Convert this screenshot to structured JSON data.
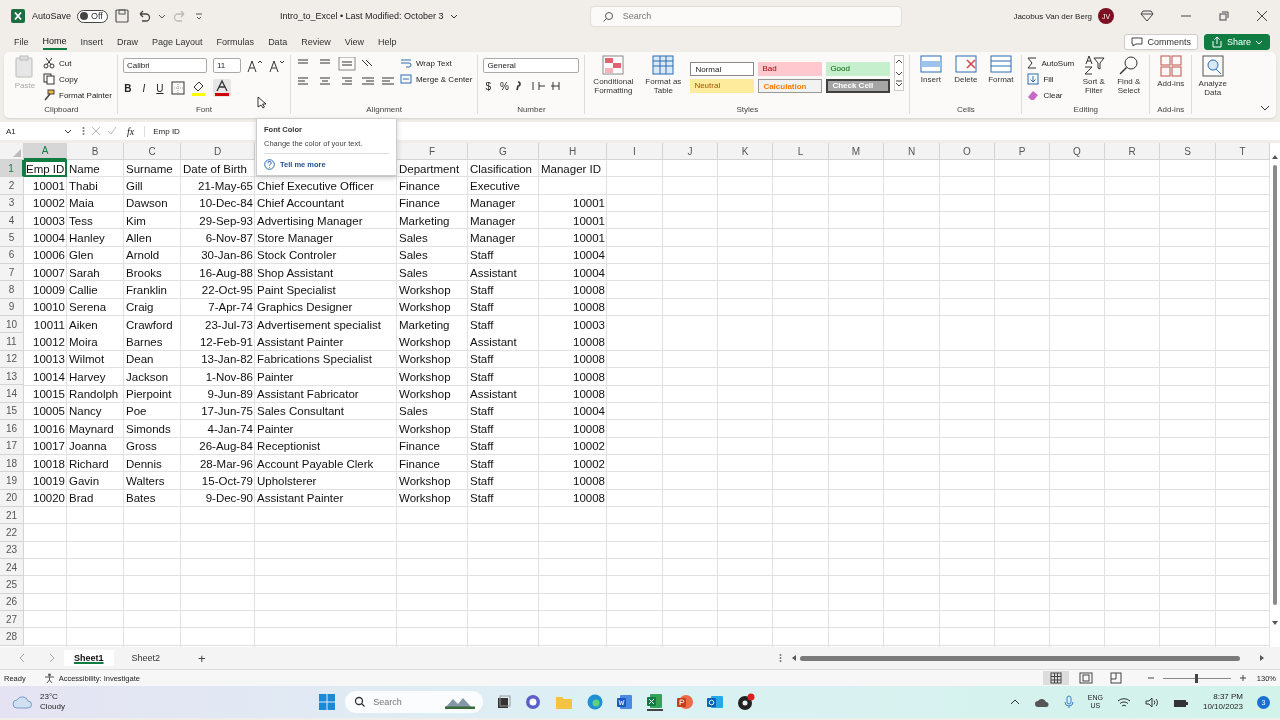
{
  "title_bar": {
    "autosave_label": "AutoSave",
    "autosave": {
      "label": "Off",
      "on": false
    },
    "document_title": "Intro_to_Excel • Last Modified: October 3",
    "search_placeholder": "Search",
    "user_name": "Jacobus Van der Berg",
    "avatar_initials": "JV"
  },
  "menu_tabs": [
    {
      "label": "File",
      "selected": false
    },
    {
      "label": "Home",
      "selected": true
    },
    {
      "label": "Insert",
      "selected": false
    },
    {
      "label": "Draw",
      "selected": false
    },
    {
      "label": "Page Layout",
      "selected": false
    },
    {
      "label": "Formulas",
      "selected": false
    },
    {
      "label": "Data",
      "selected": false
    },
    {
      "label": "Review",
      "selected": false
    },
    {
      "label": "View",
      "selected": false
    },
    {
      "label": "Help",
      "selected": false
    }
  ],
  "comments_button": "Comments",
  "share_button": "Share",
  "ribbon": {
    "clipboard": {
      "paste": "Paste",
      "cut": "Cut",
      "copy": "Copy",
      "format_painter": "Format Painter",
      "label": "Clipboard"
    },
    "font": {
      "name": "Calibri",
      "size": "11",
      "bold": "B",
      "italic": "I",
      "underline": "U",
      "label": "Font"
    },
    "alignment": {
      "wrap_text": "Wrap Text",
      "merge_center": "Merge & Center",
      "label": "Alignment"
    },
    "number": {
      "format": "General",
      "currency": "$",
      "percent": "%",
      "label": "Number"
    },
    "styles": {
      "conditional_formatting": "Conditional Formatting",
      "format_as_table": "Format as Table",
      "cell_styles": [
        {
          "label": "Normal",
          "kind": "normal"
        },
        {
          "label": "Bad",
          "kind": "bad"
        },
        {
          "label": "Good",
          "kind": "good"
        },
        {
          "label": "Neutral",
          "kind": "neutral"
        },
        {
          "label": "Calculation",
          "kind": "calculation"
        },
        {
          "label": "Check Cell",
          "kind": "check"
        }
      ],
      "label": "Styles"
    },
    "cells": {
      "insert": "Insert",
      "delete": "Delete",
      "format": "Format",
      "label": "Cells"
    },
    "editing": {
      "autosum": "AutoSum",
      "fill": "Fill",
      "clear": "Clear",
      "sort_filter": "Sort & Filter",
      "find_select": "Find & Select",
      "label": "Editing"
    },
    "addins": {
      "button": "Add-ins",
      "label": "Add-ins"
    },
    "analyze_data": "Analyze Data"
  },
  "formula_bar": {
    "name_box": "A1",
    "fx": "fx",
    "formula": "Emp ID"
  },
  "tooltip": {
    "title": "Font Color",
    "text": "Change the color of your text.",
    "link": "Tell me more"
  },
  "sheet": {
    "columns": [
      {
        "letter": "A",
        "selected": true
      },
      {
        "letter": "B",
        "selected": false
      },
      {
        "letter": "C",
        "selected": false
      },
      {
        "letter": "D",
        "selected": false
      },
      null,
      {
        "letter": "F",
        "selected": false
      },
      {
        "letter": "G",
        "selected": false
      },
      {
        "letter": "H",
        "selected": false
      },
      {
        "letter": "I",
        "selected": false
      },
      {
        "letter": "J",
        "selected": false
      },
      {
        "letter": "K",
        "selected": false
      },
      {
        "letter": "L",
        "selected": false
      },
      {
        "letter": "M",
        "selected": false
      },
      {
        "letter": "N",
        "selected": false
      },
      {
        "letter": "O",
        "selected": false
      },
      {
        "letter": "P",
        "selected": false
      },
      {
        "letter": "Q",
        "selected": false
      },
      {
        "letter": "R",
        "selected": false
      },
      {
        "letter": "S",
        "selected": false
      },
      {
        "letter": "T",
        "selected": false
      }
    ],
    "rows": [
      {
        "number": "1",
        "selected": true,
        "cells": [
          "Emp ID",
          "Name",
          "Surname",
          "Date of Birth",
          null,
          "Department",
          "Clasification",
          "Manager ID"
        ]
      },
      {
        "number": "2",
        "selected": false,
        "cells": [
          "10001",
          "Thabi",
          "Gill",
          "21-May-65",
          "Chief Executive Officer",
          "Finance",
          "Executive",
          null
        ]
      },
      {
        "number": "3",
        "selected": false,
        "cells": [
          "10002",
          "Maia",
          "Dawson",
          "10-Dec-84",
          "Chief Accountant",
          "Finance",
          "Manager",
          "10001"
        ]
      },
      {
        "number": "4",
        "selected": false,
        "cells": [
          "10003",
          "Tess",
          "Kim",
          "29-Sep-93",
          "Advertising Manager",
          "Marketing",
          "Manager",
          "10001"
        ]
      },
      {
        "number": "5",
        "selected": false,
        "cells": [
          "10004",
          "Hanley",
          "Allen",
          "6-Nov-87",
          "Store Manager",
          "Sales",
          "Manager",
          "10001"
        ]
      },
      {
        "number": "6",
        "selected": false,
        "cells": [
          "10006",
          "Glen",
          "Arnold",
          "30-Jan-86",
          "Stock Controler",
          "Sales",
          "Staff",
          "10004"
        ]
      },
      {
        "number": "7",
        "selected": false,
        "cells": [
          "10007",
          "Sarah",
          "Brooks",
          "16-Aug-88",
          "Shop Assistant",
          "Sales",
          "Assistant",
          "10004"
        ]
      },
      {
        "number": "8",
        "selected": false,
        "cells": [
          "10009",
          "Callie",
          "Franklin",
          "22-Oct-95",
          "Paint Specialist",
          "Workshop",
          "Staff",
          "10008"
        ]
      },
      {
        "number": "9",
        "selected": false,
        "cells": [
          "10010",
          "Serena",
          "Craig",
          "7-Apr-74",
          "Graphics Designer",
          "Workshop",
          "Staff",
          "10008"
        ]
      },
      {
        "number": "10",
        "selected": false,
        "cells": [
          "10011",
          "Aiken",
          "Crawford",
          "23-Jul-73",
          "Advertisement specialist",
          "Marketing",
          "Staff",
          "10003"
        ]
      },
      {
        "number": "11",
        "selected": false,
        "cells": [
          "10012",
          "Moira",
          "Barnes",
          "12-Feb-91",
          "Assistant Painter",
          "Workshop",
          "Assistant",
          "10008"
        ]
      },
      {
        "number": "12",
        "selected": false,
        "cells": [
          "10013",
          "Wilmot",
          "Dean",
          "13-Jan-82",
          "Fabrications Specialist",
          "Workshop",
          "Staff",
          "10008"
        ]
      },
      {
        "number": "13",
        "selected": false,
        "cells": [
          "10014",
          "Harvey",
          "Jackson",
          "1-Nov-86",
          "Painter",
          "Workshop",
          "Staff",
          "10008"
        ]
      },
      {
        "number": "14",
        "selected": false,
        "cells": [
          "10015",
          "Randolph",
          "Pierpoint",
          "9-Jun-89",
          "Assistant Fabricator",
          "Workshop",
          "Assistant",
          "10008"
        ]
      },
      {
        "number": "15",
        "selected": false,
        "cells": [
          "10005",
          "Nancy",
          "Poe",
          "17-Jun-75",
          "Sales Consultant",
          "Sales",
          "Staff",
          "10004"
        ]
      },
      {
        "number": "16",
        "selected": false,
        "cells": [
          "10016",
          "Maynard",
          "Simonds",
          "4-Jan-74",
          "Painter",
          "Workshop",
          "Staff",
          "10008"
        ]
      },
      {
        "number": "17",
        "selected": false,
        "cells": [
          "10017",
          "Joanna",
          "Gross",
          "26-Aug-84",
          "Receptionist",
          "Finance",
          "Staff",
          "10002"
        ]
      },
      {
        "number": "18",
        "selected": false,
        "cells": [
          "10018",
          "Richard",
          "Dennis",
          "28-Mar-96",
          "Account Payable Clerk",
          "Finance",
          "Staff",
          "10002"
        ]
      },
      {
        "number": "19",
        "selected": false,
        "cells": [
          "10019",
          "Gavin",
          "Walters",
          "15-Oct-79",
          "Upholsterer",
          "Workshop",
          "Staff",
          "10008"
        ]
      },
      {
        "number": "20",
        "selected": false,
        "cells": [
          "10020",
          "Brad",
          "Bates",
          "9-Dec-90",
          "Assistant Painter",
          "Workshop",
          "Staff",
          "10008"
        ]
      },
      {
        "number": "21",
        "selected": false
      },
      {
        "number": "22",
        "selected": false
      },
      {
        "number": "23",
        "selected": false
      },
      {
        "number": "24",
        "selected": false
      },
      {
        "number": "25",
        "selected": false
      },
      {
        "number": "26",
        "selected": false
      },
      {
        "number": "27",
        "selected": false
      },
      {
        "number": "28",
        "selected": false
      }
    ]
  },
  "sheet_tabs": [
    {
      "label": "Sheet1",
      "selected": true
    },
    {
      "label": "Sheet2",
      "selected": false
    }
  ],
  "add_sheet": "+",
  "status_bar": {
    "status": "Ready",
    "accessibility": "Accessibility: Investigate",
    "zoom": {
      "level": 0.5
    },
    "zoom_label": "130%"
  },
  "taskbar": {
    "temperature": "23°C",
    "weather": "Cloudy",
    "search_placeholder": "Search",
    "language": "ENG",
    "region": "US",
    "time": "8:37 PM",
    "date": "10/10/2023",
    "notifications": "3"
  }
}
